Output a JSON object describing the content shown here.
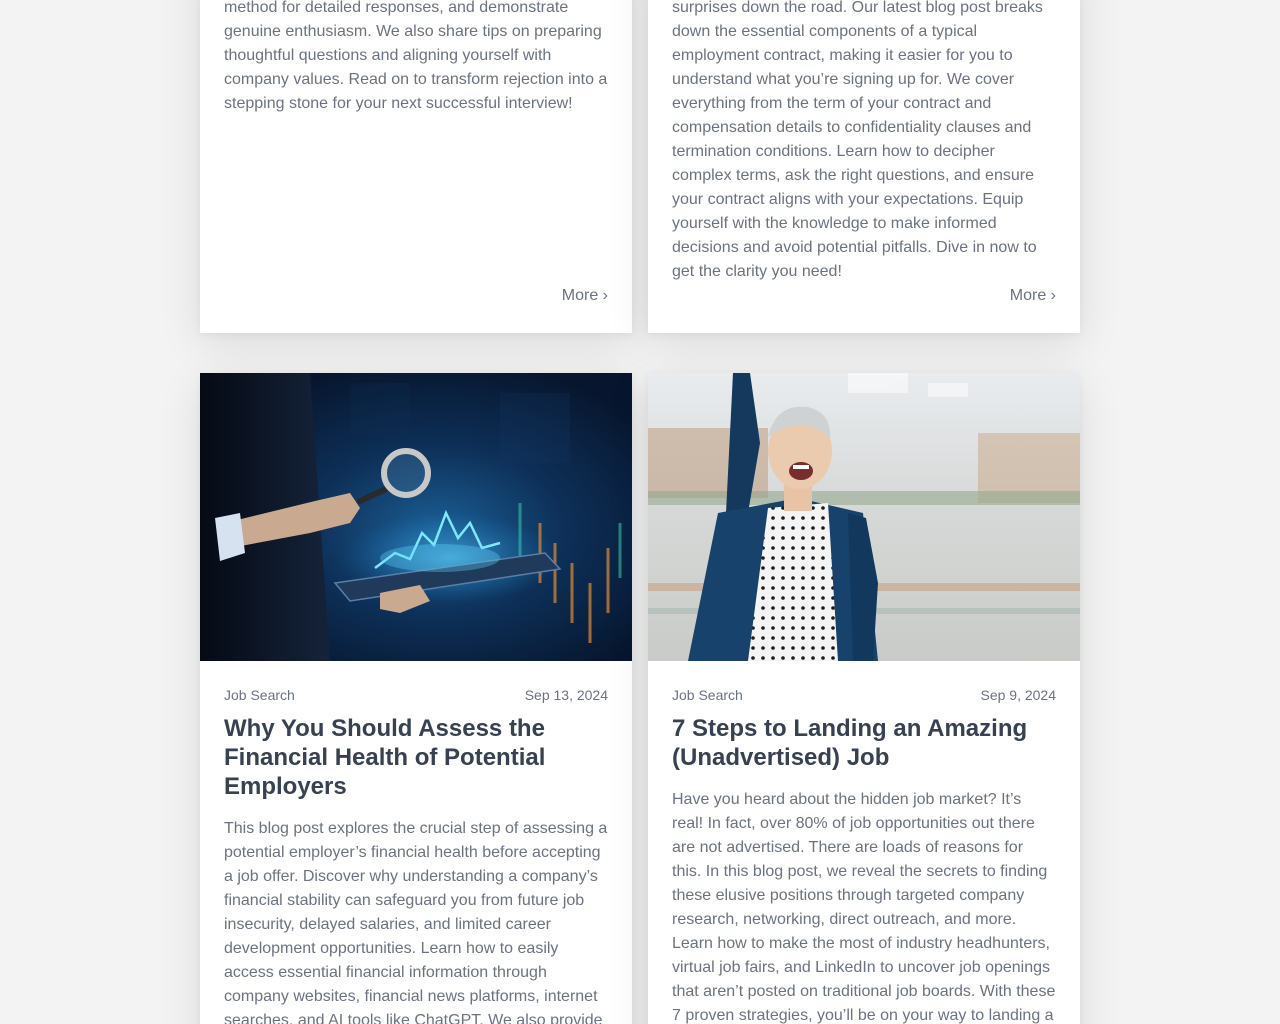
{
  "cards": [
    {
      "excerpt": "method for detailed responses, and demonstrate genuine enthusiasm. We also share tips on preparing thoughtful questions and aligning yourself with company values. Read on to transform rejection into a stepping stone for your next successful interview!",
      "more_label": "More ›"
    },
    {
      "excerpt": "surprises down the road. Our latest blog post breaks down the essential components of a typical employment contract, making it easier for you to understand what you’re signing up for. We cover everything from the term of your contract and compensation details to confidentiality clauses and termination conditions. Learn how to decipher complex terms, ask the right questions, and ensure your contract aligns with your expectations. Equip yourself with the knowledge to make informed decisions and avoid potential pitfalls. Dive in now to get the clarity you need!",
      "more_label": "More ›"
    },
    {
      "category": "Job Search",
      "date": "Sep 13, 2024",
      "title": "Why You Should Assess the Financial Health of Potential Employers",
      "excerpt": "This blog post explores the crucial step of assessing a potential employer’s financial health before accepting a job offer. Discover why understanding a company’s financial stability can safeguard you from future job insecurity, delayed salaries, and limited career development opportunities. Learn how to easily access essential financial information through company websites, financial news platforms, internet searches, and AI tools like ChatGPT. We also provide"
    },
    {
      "category": "Job Search",
      "date": "Sep 9, 2024",
      "title": "7 Steps to Landing an Amazing (Unadvertised) Job",
      "excerpt": "Have you heard about the hidden job market? It’s real! In fact, over 80% of job opportunities out there are not advertised. There are loads of reasons for this. In this blog post, we reveal the secrets to finding these elusive positions through targeted company research, networking, direct outreach, and more. Learn how to make the most of industry headhunters, virtual job fairs, and LinkedIn to uncover job openings that aren’t posted on traditional job boards. With these 7 proven strategies, you’ll be on your way to landing a"
    }
  ],
  "colors": {
    "page_bg": "#f3f3f3",
    "card_bg": "#ffffff",
    "title": "#374151",
    "body_text": "#6b7280"
  }
}
